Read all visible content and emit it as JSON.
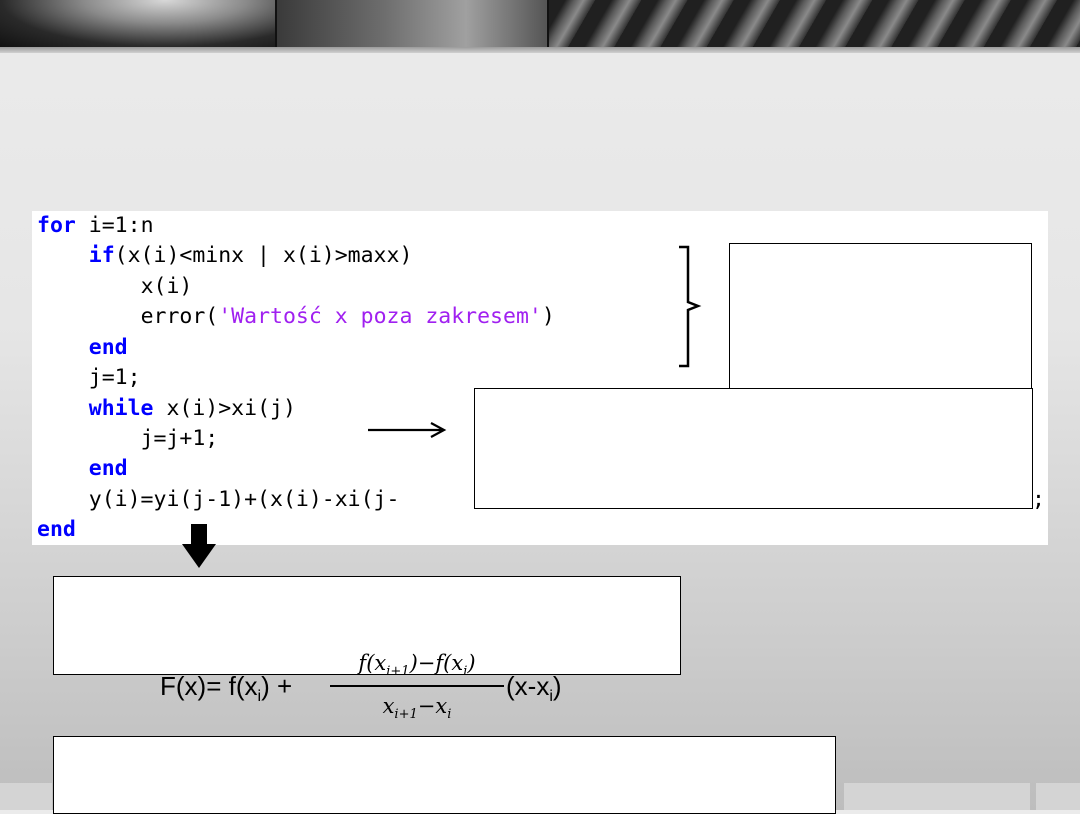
{
  "code": {
    "lines": [
      {
        "indent": "",
        "kw": "for",
        "rest": " i=1:n"
      },
      {
        "indent": "    ",
        "kw": "if",
        "rest": "(x(i)<minx | x(i)>maxx)"
      },
      {
        "indent": "        ",
        "kw": "",
        "rest": "x(i)"
      },
      {
        "indent": "        ",
        "kw": "",
        "rest": "error(",
        "str": "'Wartość x poza zakresem'",
        "after": ")"
      },
      {
        "indent": "    ",
        "kw": "end",
        "rest": ""
      },
      {
        "indent": "    ",
        "kw": "",
        "rest": "j=1;"
      },
      {
        "indent": "    ",
        "kw": "while",
        "rest": " x(i)>xi(j)"
      },
      {
        "indent": "        ",
        "kw": "",
        "rest": "j=j+1;"
      },
      {
        "indent": "    ",
        "kw": "end",
        "rest": ""
      },
      {
        "indent": "    ",
        "kw": "",
        "rest": "y(i)=yi(j-1)+(x(i)-xi(j-",
        "tail": ";"
      },
      {
        "indent": "",
        "kw": "end",
        "rest": ""
      }
    ]
  },
  "formula": {
    "lhs": "F(x)= f(x",
    "lhs_sub": "i",
    "lhs_close": ") +",
    "numerator": "f(x",
    "numerator_sub1": "i+1",
    "numerator_mid": ")−f(x",
    "numerator_sub2": "i",
    "numerator_close": ")",
    "denominator": "x",
    "denominator_sub1": "i+1",
    "denominator_mid": "−x",
    "denominator_sub2": "i",
    "rhs": "(x-x",
    "rhs_sub": "i",
    "rhs_close": ")"
  },
  "colors": {
    "keyword": "#0000ff",
    "string": "#a020f0",
    "text": "#000000"
  }
}
